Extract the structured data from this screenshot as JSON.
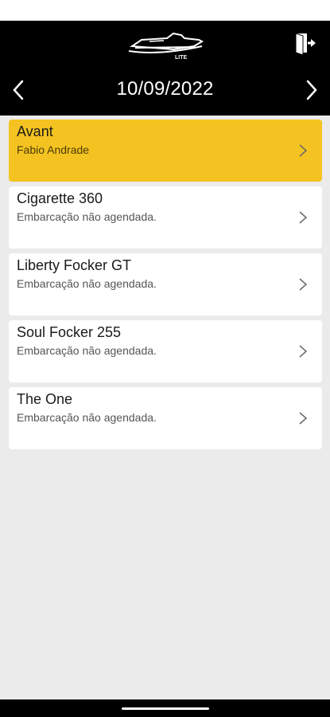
{
  "header": {
    "logo_icon": "speedboat-logo",
    "logo_text": "LITE",
    "exit_icon": "logout-icon"
  },
  "date_nav": {
    "date": "10/09/2022",
    "prev_icon": "chevron-left-icon",
    "next_icon": "chevron-right-icon"
  },
  "boats": [
    {
      "name": "Avant",
      "status": "Fabio Andrade",
      "active": true
    },
    {
      "name": "Cigarette 360",
      "status": "Embarcação não agendada.",
      "active": false
    },
    {
      "name": "Liberty Focker GT",
      "status": "Embarcação não agendada.",
      "active": false
    },
    {
      "name": "Soul Focker 255",
      "status": "Embarcação não agendada.",
      "active": false
    },
    {
      "name": "The One",
      "status": "Embarcação não agendada.",
      "active": false
    }
  ],
  "colors": {
    "header_bg": "#000000",
    "active_card": "#f4c321",
    "page_bg": "#ebebeb"
  }
}
